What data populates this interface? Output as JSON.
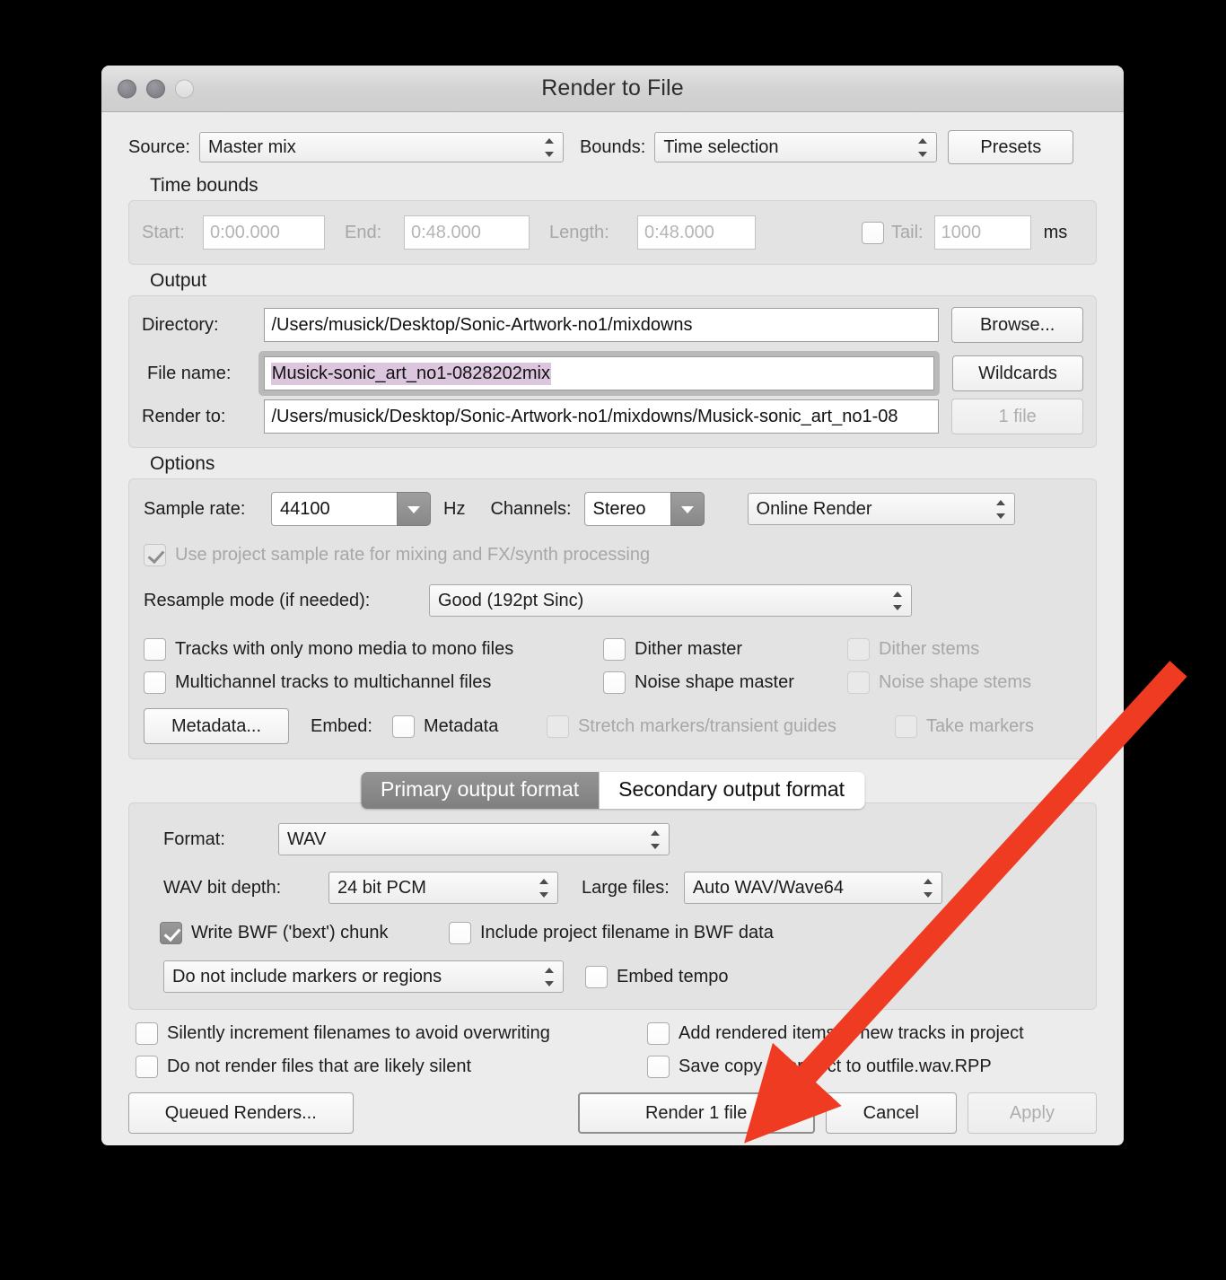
{
  "window": {
    "title": "Render to File",
    "traffic_lights": [
      "close-button",
      "minimize-button",
      "zoom-button"
    ]
  },
  "top": {
    "source_label": "Source:",
    "source_value": "Master mix",
    "bounds_label": "Bounds:",
    "bounds_value": "Time selection",
    "presets_label": "Presets"
  },
  "time_bounds": {
    "group_title": "Time bounds",
    "start_label": "Start:",
    "start_value": "0:00.000",
    "end_label": "End:",
    "end_value": "0:48.000",
    "length_label": "Length:",
    "length_value": "0:48.000",
    "tail_label": "Tail:",
    "tail_value": "1000",
    "tail_checked": false,
    "ms_label": "ms"
  },
  "output": {
    "group_title": "Output",
    "directory_label": "Directory:",
    "directory_value": "/Users/musick/Desktop/Sonic-Artwork-no1/mixdowns",
    "browse_label": "Browse...",
    "filename_label": "File name:",
    "filename_value": "Musick-sonic_art_no1-0828202mix",
    "wildcards_label": "Wildcards",
    "render_to_label": "Render to:",
    "render_to_value": "/Users/musick/Desktop/Sonic-Artwork-no1/mixdowns/Musick-sonic_art_no1-08",
    "file_count_label": "1 file"
  },
  "options": {
    "group_title": "Options",
    "sample_rate_label": "Sample rate:",
    "sample_rate_value": "44100",
    "hz_label": "Hz",
    "channels_label": "Channels:",
    "channels_value": "Stereo",
    "render_mode_value": "Online Render",
    "use_project_rate_label": "Use project sample rate for mixing and FX/synth processing",
    "use_project_rate_checked": true,
    "use_project_rate_disabled": true,
    "resample_label": "Resample mode (if needed):",
    "resample_value": "Good (192pt Sinc)",
    "checkboxes": [
      {
        "label": "Tracks with only mono media to mono files",
        "checked": false,
        "disabled": false
      },
      {
        "label": "Dither master",
        "checked": false,
        "disabled": false
      },
      {
        "label": "Dither stems",
        "checked": false,
        "disabled": true
      },
      {
        "label": "Multichannel tracks to multichannel files",
        "checked": false,
        "disabled": false
      },
      {
        "label": "Noise shape master",
        "checked": false,
        "disabled": false
      },
      {
        "label": "Noise shape stems",
        "checked": false,
        "disabled": true
      }
    ],
    "metadata_button": "Metadata...",
    "embed_label": "Embed:",
    "embed_metadata_label": "Metadata",
    "embed_metadata_checked": false,
    "stretch_markers_label": "Stretch markers/transient guides",
    "stretch_markers_checked": false,
    "stretch_markers_disabled": true,
    "take_markers_label": "Take markers",
    "take_markers_checked": false,
    "take_markers_disabled": true
  },
  "format_tabs": {
    "primary_label": "Primary output format",
    "secondary_label": "Secondary output format",
    "active": "primary"
  },
  "format": {
    "format_label": "Format:",
    "format_value": "WAV",
    "bit_depth_label": "WAV bit depth:",
    "bit_depth_value": "24 bit PCM",
    "large_files_label": "Large files:",
    "large_files_value": "Auto WAV/Wave64",
    "write_bwf_label": "Write BWF ('bext') chunk",
    "write_bwf_checked": true,
    "include_project_filename_label": "Include project filename in BWF data",
    "include_project_filename_checked": false,
    "markers_value": "Do not include markers or regions",
    "embed_tempo_label": "Embed tempo",
    "embed_tempo_checked": false
  },
  "bottom": {
    "silently_increment_label": "Silently increment filenames to avoid overwriting",
    "silently_increment_checked": false,
    "add_rendered_label": "Add rendered items to new tracks in project",
    "add_rendered_checked": false,
    "do_not_render_silent_label": "Do not render files that are likely silent",
    "do_not_render_silent_checked": false,
    "save_copy_label": "Save copy of project to outfile.wav.RPP",
    "save_copy_checked": false,
    "queued_renders_label": "Queued Renders...",
    "render_label": "Render 1 file",
    "cancel_label": "Cancel",
    "apply_label": "Apply",
    "apply_disabled": true
  },
  "annotation": {
    "type": "arrow",
    "color": "#EE3B22",
    "points_at": "render-1-file-button"
  }
}
